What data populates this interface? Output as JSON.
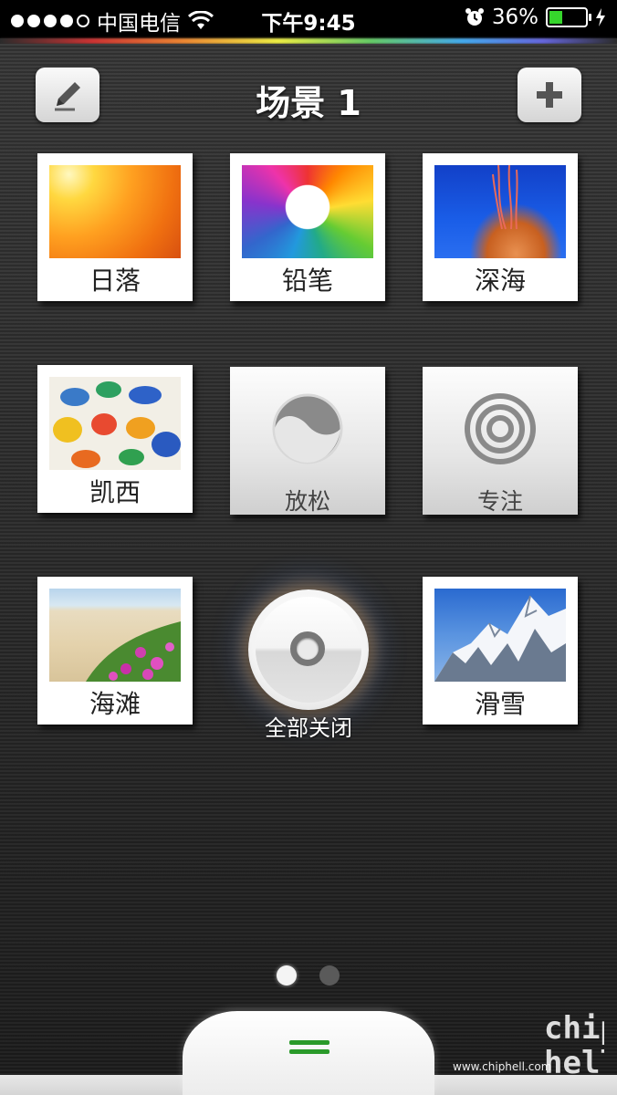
{
  "status_bar": {
    "carrier": "中国电信",
    "time": "下午9:45",
    "battery_percent": "36%",
    "battery_level": 0.36,
    "signal_dots": 5,
    "signal_filled": 4
  },
  "header": {
    "title": "场景 1",
    "edit_icon": "pencil-icon",
    "add_icon": "plus-icon"
  },
  "scenes": [
    {
      "label": "日落",
      "type": "photo",
      "image": "sunset"
    },
    {
      "label": "铅笔",
      "type": "photo",
      "image": "pencils"
    },
    {
      "label": "深海",
      "type": "photo",
      "image": "jellyfish"
    },
    {
      "label": "凯西",
      "type": "photo",
      "image": "handprints"
    },
    {
      "label": "放松",
      "type": "symbol",
      "icon": "yin-yang-icon"
    },
    {
      "label": "专注",
      "type": "symbol",
      "icon": "concentric-circles-icon"
    },
    {
      "label": "海滩",
      "type": "photo",
      "image": "beach"
    },
    {
      "label": "滑雪",
      "type": "photo",
      "image": "mountain"
    }
  ],
  "all_off": {
    "label": "全部关闭"
  },
  "pagination": {
    "pages": 2,
    "current": 1
  },
  "watermark": {
    "text": "www.chiphell.com",
    "logo": "chip\nhell"
  },
  "colors": {
    "accent_green": "#2a9a2a",
    "battery_green": "#36d62c"
  }
}
